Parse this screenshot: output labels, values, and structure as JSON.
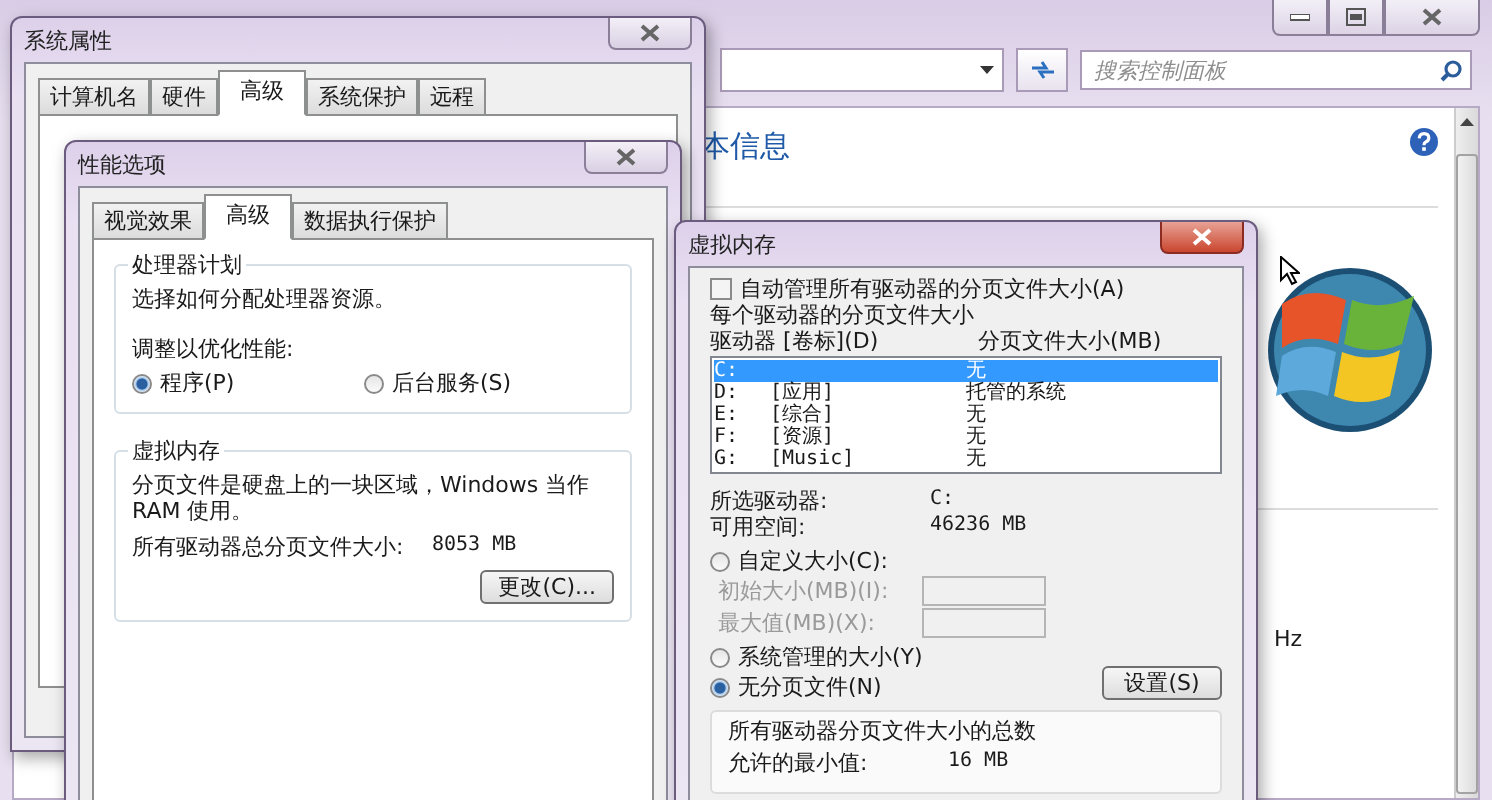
{
  "control_panel": {
    "search": {
      "placeholder": "搜索控制面板"
    },
    "heading": "本信息",
    "speed_fragment": "Hz"
  },
  "system_properties": {
    "title": "系统属性",
    "tabs": [
      {
        "label": "计算机名",
        "selected": false
      },
      {
        "label": "硬件",
        "selected": false
      },
      {
        "label": "高级",
        "selected": true
      },
      {
        "label": "系统保护",
        "selected": false
      },
      {
        "label": "远程",
        "selected": false
      }
    ]
  },
  "performance_options": {
    "title": "性能选项",
    "tabs": [
      {
        "label": "视觉效果",
        "selected": false
      },
      {
        "label": "高级",
        "selected": true
      },
      {
        "label": "数据执行保护",
        "selected": false
      }
    ],
    "processor_group": {
      "title": "处理器计划",
      "description": "选择如何分配处理器资源。",
      "adjust_label": "调整以优化性能:",
      "options": [
        {
          "label": "程序(P)",
          "selected": true
        },
        {
          "label": "后台服务(S)",
          "selected": false
        }
      ]
    },
    "virtual_memory_group": {
      "title": "虚拟内存",
      "description": "分页文件是硬盘上的一块区域，Windows 当作 RAM 使用。",
      "total_label": "所有驱动器总分页文件大小:",
      "total_value": "8053 MB",
      "change_button": "更改(C)..."
    }
  },
  "virtual_memory": {
    "title": "虚拟内存",
    "auto_manage": {
      "label": "自动管理所有驱动器的分页文件大小(A)",
      "checked": false
    },
    "per_drive_label": "每个驱动器的分页文件大小",
    "columns": [
      "驱动器 [卷标](D)",
      "分页文件大小(MB)"
    ],
    "drives": [
      {
        "drive": "C:",
        "size": "无",
        "selected": true
      },
      {
        "drive": "D:",
        "label": "[应用]",
        "size": "托管的系统",
        "selected": false
      },
      {
        "drive": "E:",
        "label": "[综合]",
        "size": "无",
        "selected": false
      },
      {
        "drive": "F:",
        "label": "[资源]",
        "size": "无",
        "selected": false
      },
      {
        "drive": "G:",
        "label": "[Music]",
        "size": "无",
        "selected": false
      }
    ],
    "selected_drive_label": "所选驱动器:",
    "selected_drive_value": "C:",
    "free_space_label": "可用空间:",
    "free_space_value": "46236 MB",
    "size_options": [
      {
        "label": "自定义大小(C):",
        "selected": false
      },
      {
        "label": "系统管理的大小(Y)",
        "selected": false
      },
      {
        "label": "无分页文件(N)",
        "selected": true
      }
    ],
    "size_fields": [
      {
        "label": "初始大小(MB)(I):",
        "disabled": true
      },
      {
        "label": "最大值(MB)(X):",
        "disabled": true
      }
    ],
    "set_button": "设置(S)",
    "totals": {
      "title": "所有驱动器分页文件大小的总数",
      "min_label": "允许的最小值:",
      "min_value": "16 MB"
    }
  }
}
